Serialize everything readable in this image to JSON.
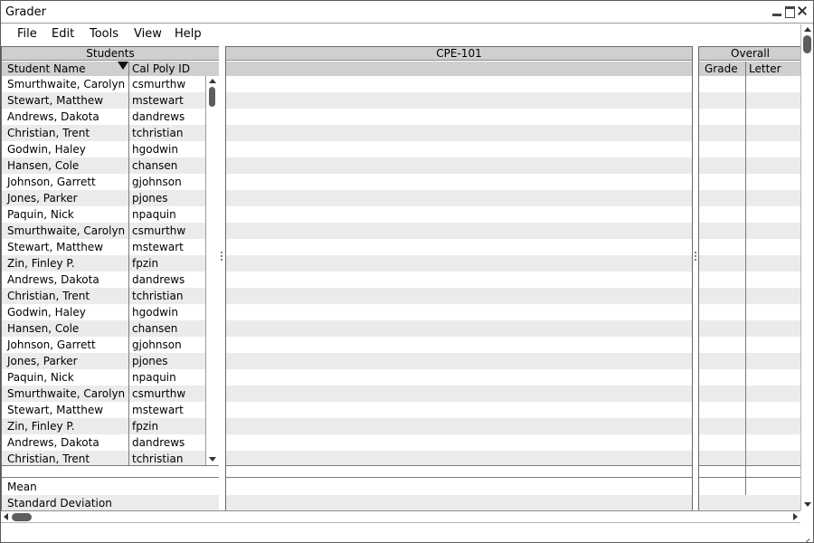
{
  "window": {
    "title": "Grader"
  },
  "menu": [
    "File",
    "Edit",
    "Tools",
    "View",
    "Help"
  ],
  "students_panel": {
    "title": "Students",
    "columns": [
      "Student Name",
      "Cal Poly ID"
    ],
    "rows": [
      [
        "Smurthwaite, Carolyn",
        "csmurthw"
      ],
      [
        "Stewart, Matthew",
        "mstewart"
      ],
      [
        "Andrews, Dakota",
        "dandrews"
      ],
      [
        "Christian, Trent",
        "tchristian"
      ],
      [
        "Godwin, Haley",
        "hgodwin"
      ],
      [
        "Hansen, Cole",
        "chansen"
      ],
      [
        "Johnson, Garrett",
        "gjohnson"
      ],
      [
        "Jones, Parker",
        "pjones"
      ],
      [
        "Paquin, Nick",
        "npaquin"
      ],
      [
        "Smurthwaite, Carolyn",
        "csmurthw"
      ],
      [
        "Stewart, Matthew",
        "mstewart"
      ],
      [
        "Zin, Finley P.",
        "fpzin"
      ],
      [
        "Andrews, Dakota",
        "dandrews"
      ],
      [
        "Christian, Trent",
        "tchristian"
      ],
      [
        "Godwin, Haley",
        "hgodwin"
      ],
      [
        "Hansen, Cole",
        "chansen"
      ],
      [
        "Johnson, Garrett",
        "gjohnson"
      ],
      [
        "Jones, Parker",
        "pjones"
      ],
      [
        "Paquin, Nick",
        "npaquin"
      ],
      [
        "Smurthwaite, Carolyn",
        "csmurthw"
      ],
      [
        "Stewart, Matthew",
        "mstewart"
      ],
      [
        "Zin, Finley P.",
        "fpzin"
      ],
      [
        "Andrews, Dakota",
        "dandrews"
      ],
      [
        "Christian, Trent",
        "tchristian"
      ]
    ],
    "summary": [
      "Mean",
      "Standard Deviation"
    ]
  },
  "course_panel": {
    "title": "CPE-101"
  },
  "overall_panel": {
    "title": "Overall",
    "columns": [
      "Grade",
      "Letter"
    ]
  },
  "colors": {
    "header_bg": "#cfcfcf",
    "row_alt": "#ebebeb",
    "border": "#6a6a6a"
  },
  "icons": {
    "minimize": "minimize-icon",
    "maximize": "maximize-icon",
    "close": "close-icon",
    "sort": "sort-descending-icon",
    "resize": "resize-grip-icon"
  }
}
